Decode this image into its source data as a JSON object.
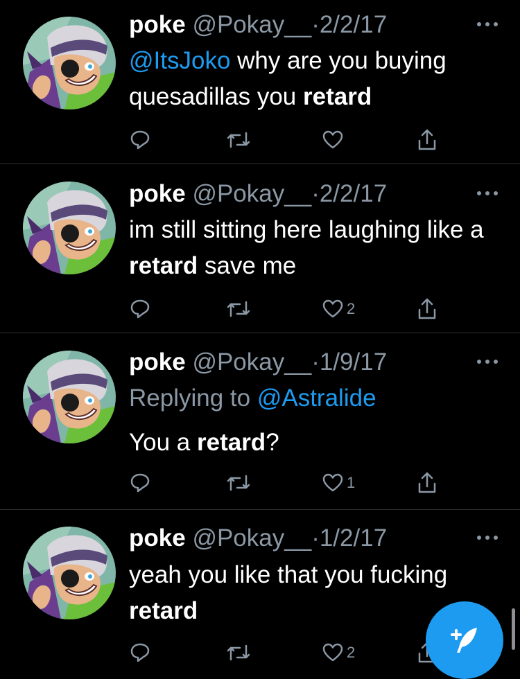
{
  "tweets": [
    {
      "name": "poke",
      "handle": "@Pokay__",
      "separator": "·",
      "date": "2/2/17",
      "reply_prefix": "",
      "reply_to": "",
      "segments": [
        {
          "text": "@ItsJoko",
          "style": "mention"
        },
        {
          "text": " why are you buying quesadillas you ",
          "style": "plain"
        },
        {
          "text": "retard",
          "style": "bold"
        }
      ],
      "like_count": ""
    },
    {
      "name": "poke",
      "handle": "@Pokay__",
      "separator": "·",
      "date": "2/2/17",
      "reply_prefix": "",
      "reply_to": "",
      "segments": [
        {
          "text": "im still sitting here laughing like a ",
          "style": "plain"
        },
        {
          "text": "retard",
          "style": "bold"
        },
        {
          "text": " save me",
          "style": "plain"
        }
      ],
      "like_count": "2"
    },
    {
      "name": "poke",
      "handle": "@Pokay__",
      "separator": "·",
      "date": "1/9/17",
      "reply_prefix": "Replying to ",
      "reply_to": "@Astralide",
      "segments": [
        {
          "text": "You a ",
          "style": "plain"
        },
        {
          "text": "retard",
          "style": "bold"
        },
        {
          "text": "?",
          "style": "plain"
        }
      ],
      "like_count": "1"
    },
    {
      "name": "poke",
      "handle": "@Pokay__",
      "separator": "·",
      "date": "1/2/17",
      "reply_prefix": "",
      "reply_to": "",
      "segments": [
        {
          "text": "yeah you like that you fucking ",
          "style": "plain"
        },
        {
          "text": "retard",
          "style": "bold"
        }
      ],
      "like_count": "2"
    }
  ],
  "icons": {
    "reply": "reply-icon",
    "retweet": "retweet-icon",
    "like": "heart-icon",
    "share": "share-icon",
    "more": "more-icon",
    "compose": "compose-tweet-icon"
  },
  "colors": {
    "background": "#000000",
    "text": "#ffffff",
    "secondary": "#8b98a5",
    "accent": "#1d9bf0",
    "divider": "#2f3336"
  }
}
